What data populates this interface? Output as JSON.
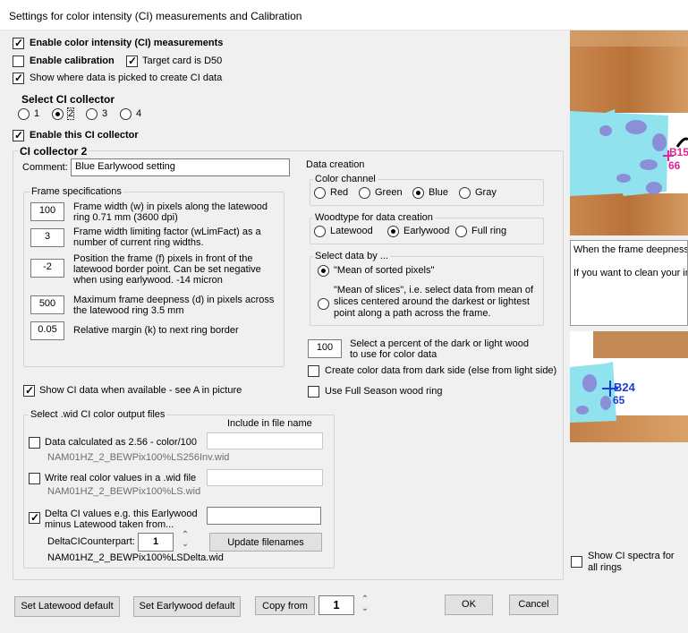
{
  "window": {
    "title": "Settings for color intensity (CI) measurements and Calibration"
  },
  "top": {
    "enable_ci": "Enable color intensity (CI) measurements",
    "enable_calibration": "Enable calibration",
    "target_card": "Target card is D50",
    "show_where": "Show where data is picked to create CI data"
  },
  "collector_select": {
    "label": "Select CI collector",
    "options": [
      "1",
      "2",
      "3",
      "4"
    ],
    "selected": "2"
  },
  "enable_this": "Enable this CI collector",
  "collector": {
    "title": "CI collector 2",
    "comment_label": "Comment:",
    "comment_value": "Blue Earlywood setting"
  },
  "frame": {
    "legend": "Frame specifications",
    "rows": [
      {
        "value": "100",
        "text": "Frame width (w) in pixels along the latewood ring 0.71 mm   (3600 dpi)"
      },
      {
        "value": "3",
        "text": "Frame width limiting factor (wLimFact) as a number of current ring widths."
      },
      {
        "value": "-2",
        "text": "Position the frame (f)  pixels in front of the latewood border point. Can be set negative when using earlywood.  -14 micron"
      },
      {
        "value": "500",
        "text": "Maximum frame deepness (d) in pixels across the latewood ring 3.5 mm"
      },
      {
        "value": "0.05",
        "text": "Relative margin (k) to next ring border"
      }
    ]
  },
  "data_creation": {
    "legend": "Data creation",
    "color_channel": {
      "legend": "Color channel",
      "options": [
        "Red",
        "Green",
        "Blue",
        "Gray"
      ],
      "selected": "Blue"
    },
    "woodtype": {
      "legend": "Woodtype for data creation",
      "options": [
        "Latewood",
        "Earlywood",
        "Full ring"
      ],
      "selected": "Earlywood"
    },
    "select_by": {
      "legend": "Select data by ...",
      "opt1": "\"Mean of sorted pixels\"",
      "opt2": "\"Mean of slices\", i.e. select data from mean of slices centered  around the darkest or lightest point along a path across the frame.",
      "selected": 1
    },
    "percent_value": "100",
    "percent_text": "Select a percent of the dark or light wood to use for color data",
    "dark_side": "Create color data from dark side (else from light side)",
    "full_season": "Use Full Season wood ring"
  },
  "show_ci": "Show CI data when available - see A in picture",
  "output": {
    "legend": "Select .wid CI color output files",
    "include_header": "Include in file name",
    "items": [
      {
        "label": "Data calculated as 2.56 - color/100",
        "file": "NAM01HZ_2_BEWPix100%LS256Inv.wid",
        "checked": false,
        "include": ""
      },
      {
        "label": "Write real color values in a .wid file",
        "file": "NAM01HZ_2_BEWPix100%LS.wid",
        "checked": false,
        "include": ""
      },
      {
        "label": "Delta CI values e.g. this Earlywood minus Latewood taken from...",
        "file": "NAM01HZ_2_BEWPix100%LSDelta.wid",
        "checked": true,
        "include": ""
      }
    ],
    "counterpart_label": "DeltaCICounterpart:",
    "counterpart_value": "1",
    "update_btn": "Update filenames"
  },
  "preview": {
    "marker1_label": "B15",
    "marker1_num": "66",
    "marker2_label": "B24",
    "marker2_num": "65",
    "help_text": "When the frame deepness ring width. The actual deep and R is the current ring wi\n\nIf you want to clean your im experiments)\"",
    "show_spectra": "Show CI spectra for all rings"
  },
  "bottom": {
    "latewood_default": "Set Latewood default",
    "earlywood_default": "Set Earlywood default",
    "copy_from": "Copy from",
    "copy_value": "1",
    "ok": "OK",
    "cancel": "Cancel"
  },
  "colors": {
    "accent_magenta": "#e0239a",
    "accent_blue": "#1a3bd6",
    "wood": "#c98a55",
    "cyan": "#8fe2ee"
  }
}
